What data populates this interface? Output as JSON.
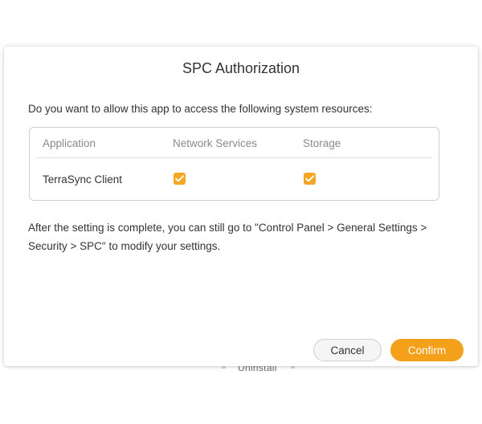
{
  "dialog": {
    "title": "SPC Authorization",
    "question": "Do you want to allow this app to access the following system resources:",
    "table": {
      "columns": [
        "Application",
        "Network Services",
        "Storage"
      ],
      "rows": [
        {
          "application": "TerraSync Client",
          "network_services": true,
          "storage": true
        }
      ]
    },
    "note": "After the setting is complete, you can still go to \"Control Panel > General Settings > Security > SPC\" to modify your settings.",
    "buttons": {
      "cancel": "Cancel",
      "confirm": "Confirm"
    }
  },
  "background": {
    "partial_text": "Uninstall"
  },
  "colors": {
    "accent": "#f5a01a",
    "checkbox": "#f5a623",
    "dialog_background": "#ffffff",
    "border": "#cfcfcf",
    "muted_text": "#8a8a8a"
  },
  "icons": {
    "checkbox": "checkmark-icon"
  }
}
